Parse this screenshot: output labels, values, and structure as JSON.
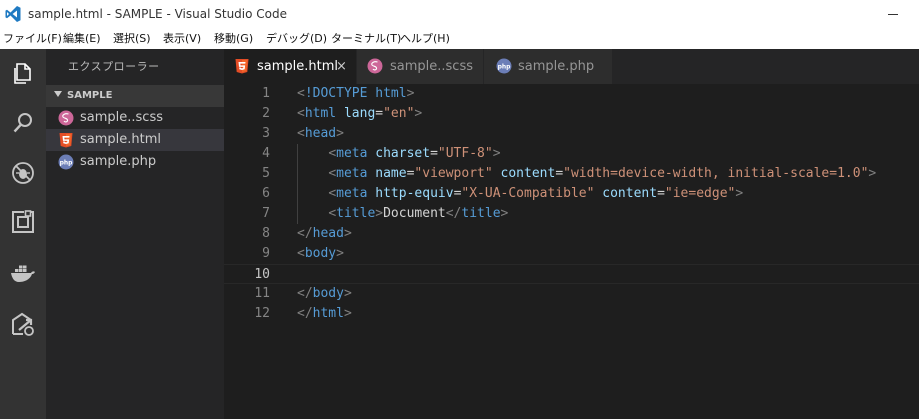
{
  "titlebar": {
    "title": "sample.html - SAMPLE - Visual Studio Code"
  },
  "menu": [
    "ファイル(F)",
    "編集(E)",
    "選択(S)",
    "表示(V)",
    "移動(G)",
    "デバッグ(D)",
    "ターミナル(T)",
    "ヘルプ(H)"
  ],
  "activitybar": [
    "explorer-icon",
    "search-icon",
    "debug-icon",
    "extensions-icon",
    "docker-icon",
    "remote-deploy-icon"
  ],
  "explorer": {
    "header": "エクスプローラー",
    "folder": "SAMPLE",
    "files": [
      {
        "name": "sample..scss",
        "icon": "sass-icon"
      },
      {
        "name": "sample.html",
        "icon": "html5-icon"
      },
      {
        "name": "sample.php",
        "icon": "php-icon"
      }
    ]
  },
  "tabs": [
    {
      "label": "sample.html",
      "icon": "html5-icon",
      "close": "×"
    },
    {
      "label": "sample..scss",
      "icon": "sass-icon"
    },
    {
      "label": "sample.php",
      "icon": "php-icon"
    }
  ],
  "editor": {
    "line_numbers": [
      "1",
      "2",
      "3",
      "4",
      "5",
      "6",
      "7",
      "8",
      "9",
      "10",
      "11",
      "12"
    ],
    "current_line": 10,
    "lines": [
      "<!DOCTYPE html>",
      "<html lang=\"en\">",
      "<head>",
      "    <meta charset=\"UTF-8\">",
      "    <meta name=\"viewport\" content=\"width=device-width, initial-scale=1.0\">",
      "    <meta http-equiv=\"X-UA-Compatible\" content=\"ie=edge\">",
      "    <title>Document</title>",
      "</head>",
      "<body>",
      "",
      "</body>",
      "</html>"
    ]
  },
  "colors": {
    "tag": "#569cd6",
    "attribute": "#9cdcfe",
    "string": "#ce9178",
    "punctuation": "#808080",
    "text": "#d4d4d4"
  }
}
